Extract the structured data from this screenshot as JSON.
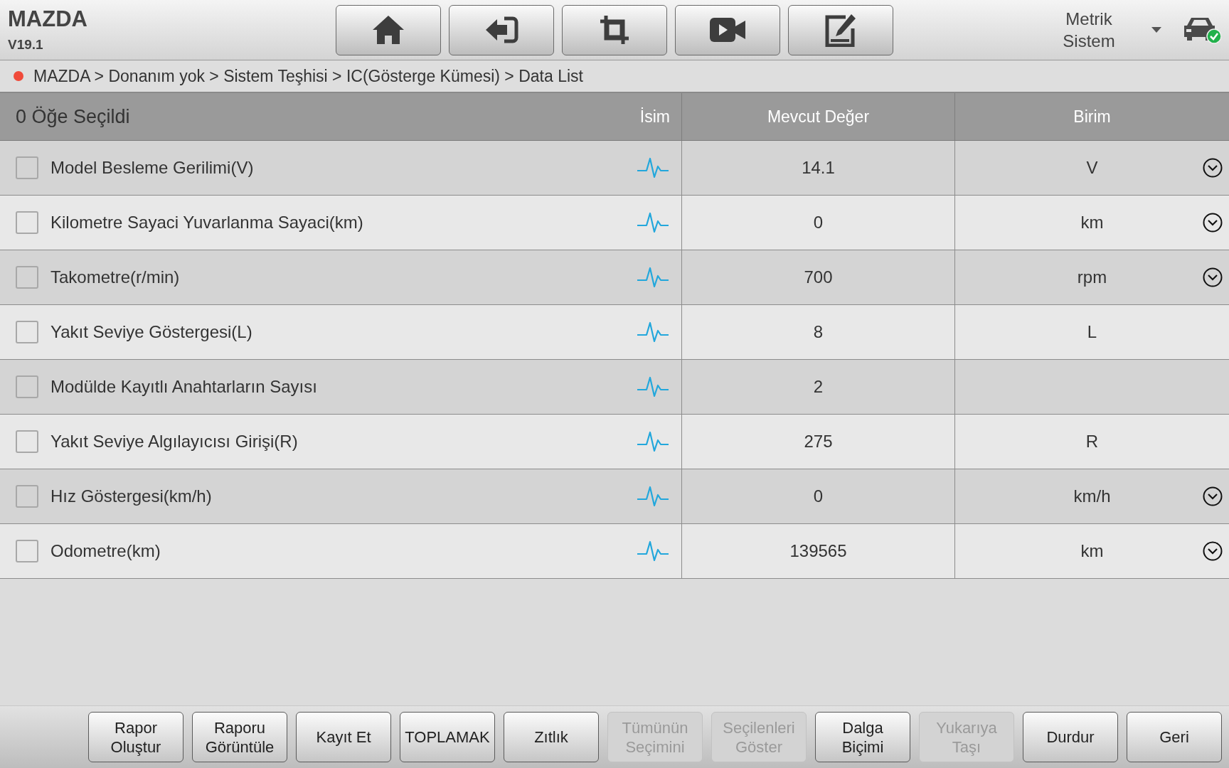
{
  "header": {
    "title": "MAZDA",
    "version": "V19.1",
    "unit_system": "Metrik Sistem"
  },
  "breadcrumb": "MAZDA > Donanım yok > Sistem Teşhisi > IC(Gösterge Kümesi) > Data List",
  "table": {
    "selection_summary": "0 Öğe Seçildi",
    "columns": [
      "İsim",
      "Mevcut Değer",
      "Birim"
    ],
    "rows": [
      {
        "name": "Model Besleme Gerilimi(V)",
        "checked": false,
        "value": "14.1",
        "unit": "V",
        "expandable": true
      },
      {
        "name": "Kilometre Sayaci Yuvarlanma Sayaci(km)",
        "checked": false,
        "value": "0",
        "unit": "km",
        "expandable": true
      },
      {
        "name": "Takometre(r/min)",
        "checked": false,
        "value": "700",
        "unit": "rpm",
        "expandable": true
      },
      {
        "name": "Yakıt Seviye Göstergesi(L)",
        "checked": false,
        "value": "8",
        "unit": "L",
        "expandable": false
      },
      {
        "name": "Modülde Kayıtlı Anahtarların Sayısı",
        "checked": false,
        "value": "2",
        "expandable": false
      },
      {
        "name": "Yakıt Seviye Algılayıcısı Girişi(R)",
        "checked": false,
        "value": "275",
        "unit": "R",
        "expandable": false
      },
      {
        "name": "Hız Göstergesi(km/h)",
        "checked": false,
        "value": "0",
        "unit": "km/h",
        "expandable": true
      },
      {
        "name": "Odometre(km)",
        "checked": false,
        "value": "139565",
        "unit": "km",
        "expandable": true
      }
    ]
  },
  "buttons": [
    {
      "label": "Rapor\nOluştur",
      "disabled": false
    },
    {
      "label": "Raporu\nGörüntüle",
      "disabled": false
    },
    {
      "label": "Kayıt Et",
      "disabled": false
    },
    {
      "label": "TOPLAMAK",
      "disabled": false
    },
    {
      "label": "Zıtlık",
      "disabled": false
    },
    {
      "label": "Tümünün\nSeçimini",
      "disabled": true
    },
    {
      "label": "Seçilenleri\nGöster",
      "disabled": true
    },
    {
      "label": "Dalga\nBiçimi",
      "disabled": false
    },
    {
      "label": "Yukarıya\nTaşı",
      "disabled": true
    },
    {
      "label": "Durdur",
      "disabled": false
    },
    {
      "label": "Geri",
      "disabled": false
    }
  ]
}
